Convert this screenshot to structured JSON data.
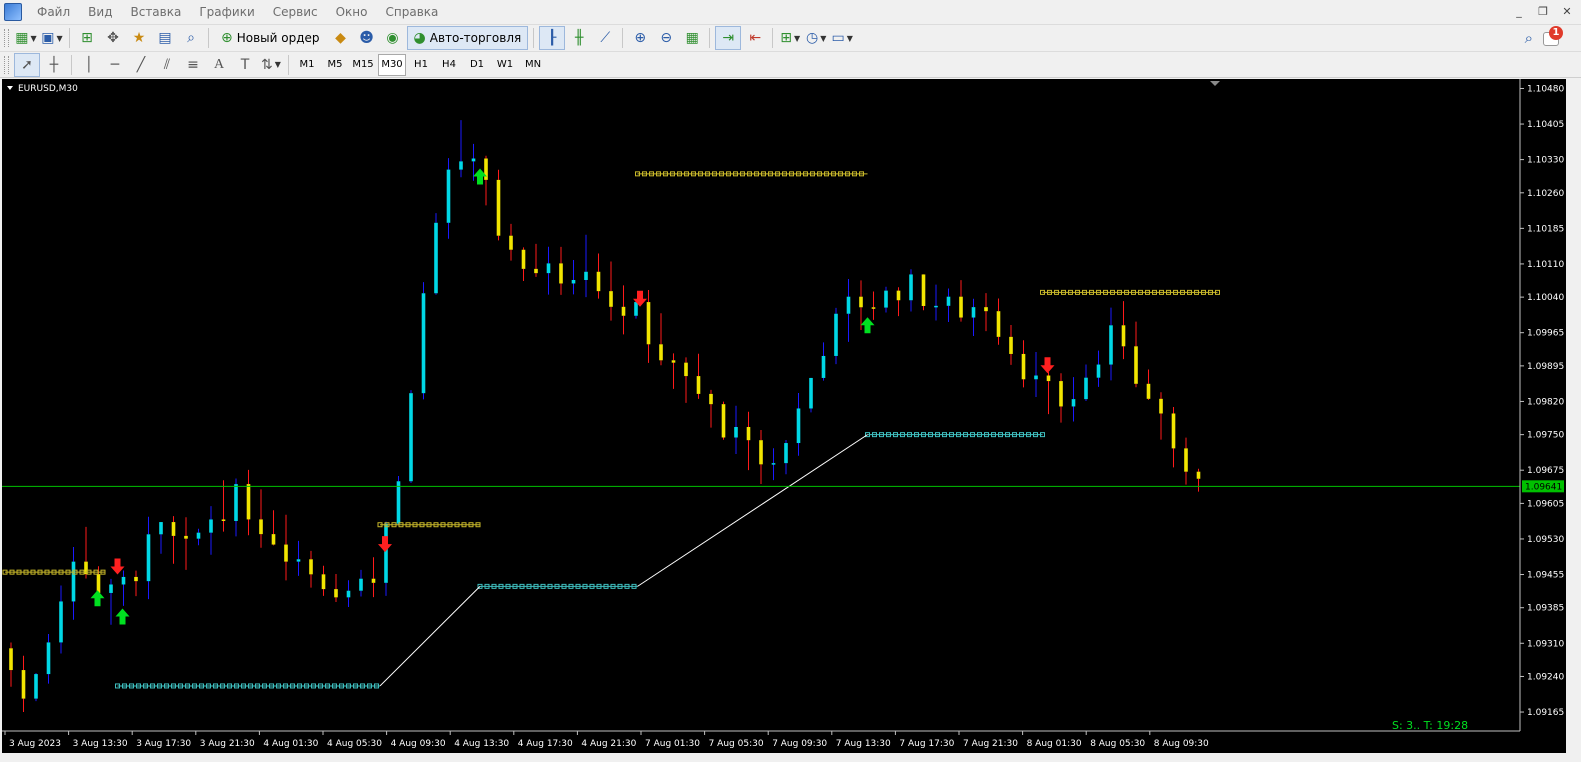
{
  "menu": {
    "items": [
      "Файл",
      "Вид",
      "Вставка",
      "Графики",
      "Сервис",
      "Окно",
      "Справка"
    ]
  },
  "toolbar": {
    "new_order_label": "Новый ордер",
    "autotrading_label": "Авто-торговля"
  },
  "timeframes": [
    "M1",
    "M5",
    "M15",
    "M30",
    "H1",
    "H4",
    "D1",
    "W1",
    "MN"
  ],
  "active_timeframe": "M30",
  "notifications": {
    "count": "1"
  },
  "chart": {
    "symbol_label": "EURUSD,M30",
    "current_price": "1.09641",
    "status_text": "S: 3.. T: 19:28",
    "colors": {
      "bull": "#00d8e6",
      "bear": "#f2e500",
      "wick_up": "#1a1aff",
      "wick_down": "#ff1a1a",
      "support": "#3fbfbf",
      "resistance": "#c8b82a",
      "buy_arrow": "#00e020",
      "sell_arrow": "#ff2020",
      "price_line": "#00c000"
    }
  },
  "chart_data": {
    "type": "candlestick",
    "symbol": "EURUSD",
    "timeframe": "M30",
    "y_ticks": [
      "1.10480",
      "1.10405",
      "1.10330",
      "1.10260",
      "1.10185",
      "1.10110",
      "1.10040",
      "1.09965",
      "1.09895",
      "1.09820",
      "1.09750",
      "1.09675",
      "1.09605",
      "1.09530",
      "1.09455",
      "1.09385",
      "1.09310",
      "1.09240",
      "1.09165"
    ],
    "ylim": [
      1.09125,
      1.105
    ],
    "x_ticks": [
      "3 Aug 2023",
      "3 Aug 13:30",
      "3 Aug 17:30",
      "3 Aug 21:30",
      "4 Aug 01:30",
      "4 Aug 05:30",
      "4 Aug 09:30",
      "4 Aug 13:30",
      "4 Aug 17:30",
      "4 Aug 21:30",
      "7 Aug 01:30",
      "7 Aug 05:30",
      "7 Aug 09:30",
      "7 Aug 13:30",
      "7 Aug 17:30",
      "7 Aug 21:30",
      "8 Aug 01:30",
      "8 Aug 05:30",
      "8 Aug 09:30"
    ],
    "close_anchors": [
      1.093,
      1.092,
      1.0935,
      1.095,
      1.094,
      1.0945,
      1.0955,
      1.095,
      1.0958,
      1.0962,
      1.0955,
      1.095,
      1.0945,
      1.0942,
      1.0945,
      1.0965,
      1.1005,
      1.1035,
      1.103,
      1.1015,
      1.101,
      1.1008,
      1.1012,
      1.1003,
      1.1,
      1.099,
      1.0985,
      1.0978,
      1.0972,
      1.0968,
      1.098,
      1.0995,
      1.1003,
      1.1003,
      1.1007,
      1.1003,
      1.1001,
      1.1003,
      1.0993,
      1.0985,
      1.0981,
      1.0988,
      1.0998,
      1.0983,
      1.0972,
      1.0963
    ],
    "resistance_levels": [
      {
        "from_index": 0,
        "to_index": 40,
        "value": 1.0946,
        "label_time": "3 Aug 2023"
      },
      {
        "from_index": 150,
        "to_index": 190,
        "value": 1.0956
      },
      {
        "from_index": 253,
        "to_index": 345,
        "value": 1.103
      },
      {
        "from_index": 415,
        "to_index": 485,
        "value": 1.1005
      }
    ],
    "support_levels": [
      {
        "from_index": 45,
        "to_index": 150,
        "value": 1.0922
      },
      {
        "from_index": 190,
        "to_index": 253,
        "value": 1.0943
      },
      {
        "from_index": 345,
        "to_index": 415,
        "value": 1.0975
      }
    ],
    "buy_signals": [
      37,
      47,
      190,
      345
    ],
    "sell_signals": [
      45,
      152,
      254,
      417
    ]
  }
}
